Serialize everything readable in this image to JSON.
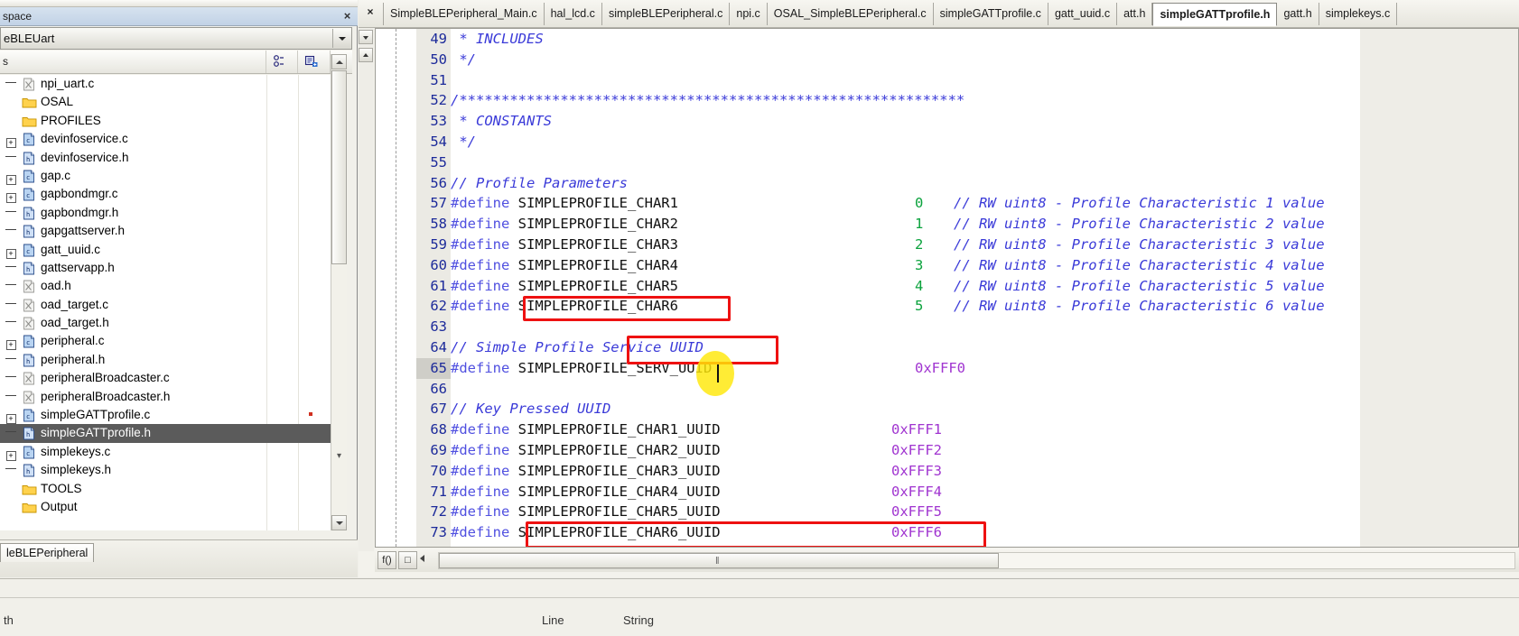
{
  "workspace": {
    "title": "space",
    "close_label": "×",
    "project_selector": "eBLEUart",
    "column_header": "s",
    "header_icons": [
      "relations-icon",
      "make-icon"
    ],
    "bottom_tab": "leBLEPeripheral",
    "tree": [
      {
        "indent": 0,
        "marker": "dash",
        "icon": "x-file-icon",
        "label": "npi_uart.c",
        "selected": false,
        "dot": false
      },
      {
        "indent": 0,
        "marker": "none",
        "icon": "folder-icon",
        "label": "OSAL",
        "selected": false,
        "dot": false
      },
      {
        "indent": 0,
        "marker": "none",
        "icon": "folder-icon",
        "label": "PROFILES",
        "selected": false,
        "dot": false
      },
      {
        "indent": 0,
        "marker": "plus",
        "icon": "c-file-icon",
        "label": "devinfoservice.c",
        "selected": false,
        "dot": false
      },
      {
        "indent": 0,
        "marker": "dash",
        "icon": "h-file-icon",
        "label": "devinfoservice.h",
        "selected": false,
        "dot": false
      },
      {
        "indent": 0,
        "marker": "plus",
        "icon": "c-file-icon",
        "label": "gap.c",
        "selected": false,
        "dot": false
      },
      {
        "indent": 0,
        "marker": "plus",
        "icon": "c-file-icon",
        "label": "gapbondmgr.c",
        "selected": false,
        "dot": false
      },
      {
        "indent": 0,
        "marker": "dash",
        "icon": "h-file-icon",
        "label": "gapbondmgr.h",
        "selected": false,
        "dot": false
      },
      {
        "indent": 0,
        "marker": "dash",
        "icon": "h-file-icon",
        "label": "gapgattserver.h",
        "selected": false,
        "dot": false
      },
      {
        "indent": 0,
        "marker": "plus",
        "icon": "c-file-icon",
        "label": "gatt_uuid.c",
        "selected": false,
        "dot": false
      },
      {
        "indent": 0,
        "marker": "dash",
        "icon": "h-file-icon",
        "label": "gattservapp.h",
        "selected": false,
        "dot": false
      },
      {
        "indent": 0,
        "marker": "dash",
        "icon": "x-file-icon",
        "label": "oad.h",
        "selected": false,
        "dot": false
      },
      {
        "indent": 0,
        "marker": "dash",
        "icon": "x-file-icon",
        "label": "oad_target.c",
        "selected": false,
        "dot": false
      },
      {
        "indent": 0,
        "marker": "dash",
        "icon": "x-file-icon",
        "label": "oad_target.h",
        "selected": false,
        "dot": false
      },
      {
        "indent": 0,
        "marker": "plus",
        "icon": "c-file-icon",
        "label": "peripheral.c",
        "selected": false,
        "dot": false
      },
      {
        "indent": 0,
        "marker": "dash",
        "icon": "h-file-icon",
        "label": "peripheral.h",
        "selected": false,
        "dot": false
      },
      {
        "indent": 0,
        "marker": "dash",
        "icon": "x-file-icon",
        "label": "peripheralBroadcaster.c",
        "selected": false,
        "dot": false
      },
      {
        "indent": 0,
        "marker": "dash",
        "icon": "x-file-icon",
        "label": "peripheralBroadcaster.h",
        "selected": false,
        "dot": false
      },
      {
        "indent": 0,
        "marker": "plus",
        "icon": "c-file-icon",
        "label": "simpleGATTprofile.c",
        "selected": false,
        "dot": true
      },
      {
        "indent": 0,
        "marker": "dash",
        "icon": "h-file-icon",
        "label": "simpleGATTprofile.h",
        "selected": true,
        "dot": false
      },
      {
        "indent": 0,
        "marker": "plus",
        "icon": "c-file-icon",
        "label": "simplekeys.c",
        "selected": false,
        "dot": false
      },
      {
        "indent": 0,
        "marker": "dash",
        "icon": "h-file-icon",
        "label": "simplekeys.h",
        "selected": false,
        "dot": false
      },
      {
        "indent": 0,
        "marker": "none",
        "icon": "folder-icon",
        "label": "TOOLS",
        "selected": false,
        "dot": false
      },
      {
        "indent": 0,
        "marker": "none",
        "icon": "folder-icon",
        "label": "Output",
        "selected": false,
        "dot": false
      }
    ]
  },
  "editor": {
    "close_label": "×",
    "tabs": [
      {
        "label": "SimpleBLEPeripheral_Main.c",
        "active": false
      },
      {
        "label": "hal_lcd.c",
        "active": false
      },
      {
        "label": "simpleBLEPeripheral.c",
        "active": false
      },
      {
        "label": "npi.c",
        "active": false
      },
      {
        "label": "OSAL_SimpleBLEPeripheral.c",
        "active": false
      },
      {
        "label": "simpleGATTprofile.c",
        "active": false
      },
      {
        "label": "gatt_uuid.c",
        "active": false
      },
      {
        "label": "att.h",
        "active": false
      },
      {
        "label": "simpleGATTprofile.h",
        "active": true
      },
      {
        "label": "gatt.h",
        "active": false
      },
      {
        "label": "simplekeys.c",
        "active": false
      }
    ],
    "hscroll": {
      "fold_button": "f()",
      "collapse_button": "□",
      "grip": "‖"
    },
    "code": [
      {
        "num": "49",
        "text": " * INCLUDES",
        "kind": "comment",
        "value": "",
        "comment": "",
        "current": false
      },
      {
        "num": "50",
        "text": " */",
        "kind": "comment",
        "value": "",
        "comment": "",
        "current": false
      },
      {
        "num": "51",
        "text": "",
        "kind": "plain",
        "value": "",
        "comment": "",
        "current": false
      },
      {
        "num": "52",
        "text": "/************************************************************",
        "kind": "comment",
        "value": "",
        "comment": "",
        "current": false
      },
      {
        "num": "53",
        "text": " * CONSTANTS",
        "kind": "comment",
        "value": "",
        "comment": "",
        "current": false
      },
      {
        "num": "54",
        "text": " */",
        "kind": "comment",
        "value": "",
        "comment": "",
        "current": false
      },
      {
        "num": "55",
        "text": "",
        "kind": "plain",
        "value": "",
        "comment": "",
        "current": false
      },
      {
        "num": "56",
        "text": "// Profile Parameters",
        "kind": "comment",
        "value": "",
        "comment": "",
        "current": false
      },
      {
        "num": "57",
        "text": "#define SIMPLEPROFILE_CHAR1",
        "kind": "define",
        "value": "0",
        "comment": "// RW uint8 - Profile Characteristic 1 value",
        "current": false
      },
      {
        "num": "58",
        "text": "#define SIMPLEPROFILE_CHAR2",
        "kind": "define",
        "value": "1",
        "comment": "// RW uint8 - Profile Characteristic 2 value",
        "current": false
      },
      {
        "num": "59",
        "text": "#define SIMPLEPROFILE_CHAR3",
        "kind": "define",
        "value": "2",
        "comment": "// RW uint8 - Profile Characteristic 3 value",
        "current": false
      },
      {
        "num": "60",
        "text": "#define SIMPLEPROFILE_CHAR4",
        "kind": "define",
        "value": "3",
        "comment": "// RW uint8 - Profile Characteristic 4 value",
        "current": false
      },
      {
        "num": "61",
        "text": "#define SIMPLEPROFILE_CHAR5",
        "kind": "define",
        "value": "4",
        "comment": "// RW uint8 - Profile Characteristic 5 value",
        "current": false
      },
      {
        "num": "62",
        "text": "#define SIMPLEPROFILE_CHAR6",
        "kind": "define",
        "value": "5",
        "comment": "// RW uint8 - Profile Characteristic 6 value",
        "current": false
      },
      {
        "num": "63",
        "text": "",
        "kind": "plain",
        "value": "",
        "comment": "",
        "current": false
      },
      {
        "num": "64",
        "text": "// Simple Profile Service UUID",
        "kind": "comment",
        "value": "",
        "comment": "",
        "current": false
      },
      {
        "num": "65",
        "text": "#define SIMPLEPROFILE_SERV_UUID",
        "kind": "define",
        "value": "",
        "comment": "",
        "hex": "0xFFF0",
        "current": true
      },
      {
        "num": "66",
        "text": "",
        "kind": "plain",
        "value": "",
        "comment": "",
        "current": false
      },
      {
        "num": "67",
        "text": "// Key Pressed UUID",
        "kind": "comment",
        "value": "",
        "comment": "",
        "current": false
      },
      {
        "num": "68",
        "text": "#define SIMPLEPROFILE_CHAR1_UUID",
        "kind": "define",
        "value": "",
        "comment": "",
        "hex": "0xFFF1",
        "current": false
      },
      {
        "num": "69",
        "text": "#define SIMPLEPROFILE_CHAR2_UUID",
        "kind": "define",
        "value": "",
        "comment": "",
        "hex": "0xFFF2",
        "current": false
      },
      {
        "num": "70",
        "text": "#define SIMPLEPROFILE_CHAR3_UUID",
        "kind": "define",
        "value": "",
        "comment": "",
        "hex": "0xFFF3",
        "current": false
      },
      {
        "num": "71",
        "text": "#define SIMPLEPROFILE_CHAR4_UUID",
        "kind": "define",
        "value": "",
        "comment": "",
        "hex": "0xFFF4",
        "current": false
      },
      {
        "num": "72",
        "text": "#define SIMPLEPROFILE_CHAR5_UUID",
        "kind": "define",
        "value": "",
        "comment": "",
        "hex": "0xFFF5",
        "current": false
      },
      {
        "num": "73",
        "text": "#define SIMPLEPROFILE_CHAR6_UUID",
        "kind": "define",
        "value": "",
        "comment": "",
        "hex": "0xFFF6",
        "current": false
      }
    ]
  },
  "status": {
    "left_text": "th",
    "line_label": "Line",
    "string_label": "String"
  },
  "colors": {
    "comment": "#3a3ad8",
    "keyword": "#5050e0",
    "number": "#0aa23c",
    "hex": "#a034d0",
    "linenumber": "#1c2a9a",
    "annotation_red": "#ee1111",
    "highlight_yellow": "#ffe808",
    "selection": "#5b5b5b"
  }
}
